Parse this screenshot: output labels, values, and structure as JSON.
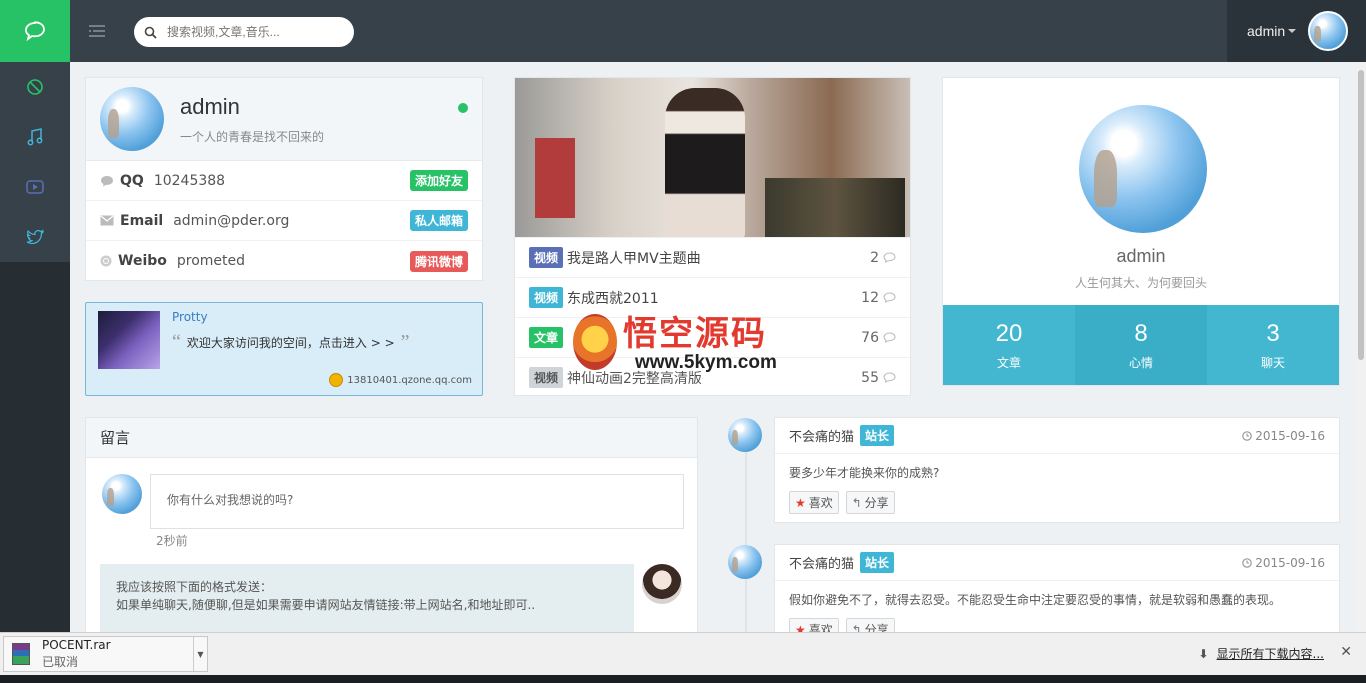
{
  "header": {
    "search_placeholder": "搜索视频,文章,音乐...",
    "user_name": "admin"
  },
  "profile": {
    "name": "admin",
    "bio": "一个人的青春是找不回来的",
    "rows": [
      {
        "label": "QQ",
        "value": "10245388",
        "action": "添加好友",
        "color": "#27c266"
      },
      {
        "label": "Email",
        "value": "admin@pder.org",
        "action": "私人邮箱",
        "color": "#3fb6d6"
      },
      {
        "label": "Weibo",
        "value": "prometed",
        "action": "腾讯微博",
        "color": "#e85a5a"
      }
    ]
  },
  "qzone": {
    "name": "Protty",
    "text": "欢迎大家访问我的空间，点击进入 > >",
    "link": "13810401.qzone.qq.com"
  },
  "posts": [
    {
      "tag": "视频",
      "tag_color": "#5a6fb5",
      "title": "我是路人甲MV主题曲",
      "count": "2"
    },
    {
      "tag": "视频",
      "tag_color": "#3fb6d6",
      "title": "东成西就2011",
      "count": "12"
    },
    {
      "tag": "文章",
      "tag_color": "#27c266",
      "title": "",
      "count": "76"
    },
    {
      "tag": "视频",
      "tag_color": "#cfd4d8",
      "title": "神仙动画2完整高清版",
      "count": "55"
    }
  ],
  "watermark": {
    "title": "悟空源码",
    "url": "www.5kym.com"
  },
  "user_card": {
    "name": "admin",
    "motto": "人生何其大、为何要回头",
    "stats": [
      {
        "num": "20",
        "label": "文章"
      },
      {
        "num": "8",
        "label": "心情"
      },
      {
        "num": "3",
        "label": "聊天"
      }
    ]
  },
  "messages": {
    "title": "留言",
    "input_placeholder": "你有什么对我想说的吗?",
    "time": "2秒前",
    "reply_line1": "我应该按照下面的格式发送：",
    "reply_line2": "如果单纯聊天,随便聊,但是如果需要申请网站友情链接:带上网站名,和地址即可.."
  },
  "feed": [
    {
      "author": "不会痛的猫",
      "badge": "站长",
      "date": "2015-09-16",
      "body": "要多少年才能换来你的成熟?",
      "like": "喜欢",
      "share": "分享"
    },
    {
      "author": "不会痛的猫",
      "badge": "站长",
      "date": "2015-09-16",
      "body": "假如你避免不了，就得去忍受。不能忍受生命中注定要忍受的事情，就是软弱和愚蠢的表现。",
      "like": "喜欢",
      "share": "分享"
    }
  ],
  "download": {
    "file": "POCENT.rar",
    "status": "已取消",
    "show_all": "显示所有下载内容..."
  }
}
